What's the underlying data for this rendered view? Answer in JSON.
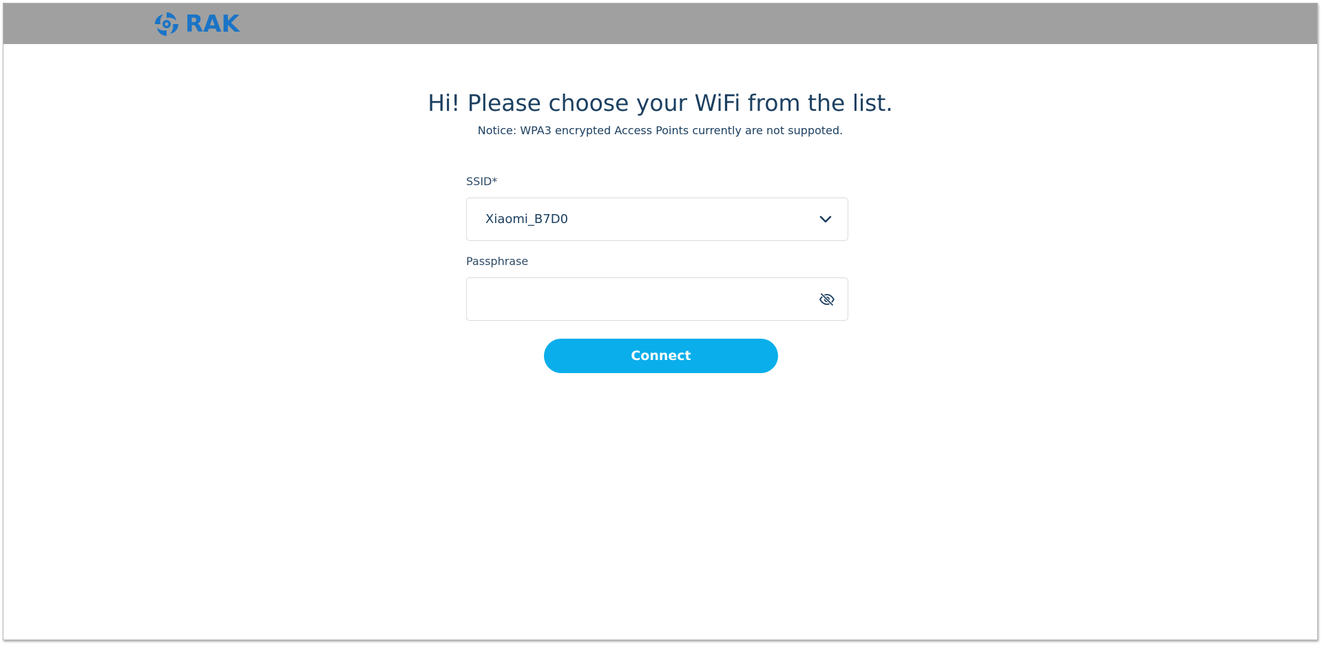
{
  "header": {
    "brand": "RAK",
    "logo_icon": "rak-logo-icon",
    "background_color": "#a0a0a0",
    "brand_color": "#1a74c7"
  },
  "main": {
    "title": "Hi! Please choose your WiFi from the list.",
    "notice": "Notice: WPA3 encrypted Access Points currently are not suppoted.",
    "text_color": "#1c3f60"
  },
  "form": {
    "ssid_label": "SSID*",
    "ssid_value": "Xiaomi_B7D0",
    "ssid_icon": "chevron-down-icon",
    "passphrase_label": "Passphrase",
    "passphrase_value": "",
    "passphrase_icon": "eye-slash-icon",
    "connect_label": "Connect",
    "button_color": "#0aaeea"
  }
}
